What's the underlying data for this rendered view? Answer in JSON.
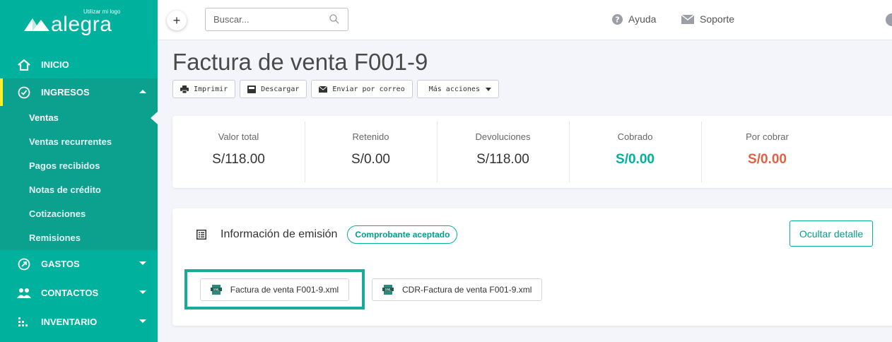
{
  "brand": {
    "tagline": "Utilizar mi logo",
    "name": "alegra"
  },
  "sidebar": {
    "items": [
      {
        "label": "INICIO",
        "icon": "home-icon"
      },
      {
        "label": "INGRESOS",
        "icon": "check-circle-icon",
        "expanded": true
      },
      {
        "label": "GASTOS",
        "icon": "arrow-circle-icon"
      },
      {
        "label": "CONTACTOS",
        "icon": "people-icon"
      },
      {
        "label": "INVENTARIO",
        "icon": "inventory-icon"
      }
    ],
    "ingresos_sub": [
      "Ventas",
      "Ventas recurrentes",
      "Pagos recibidos",
      "Notas de crédito",
      "Cotizaciones",
      "Remisiones"
    ]
  },
  "topbar": {
    "search_placeholder": "Buscar...",
    "help_label": "Ayuda",
    "support_label": "Soporte"
  },
  "page": {
    "title": "Factura de venta F001-9",
    "actions": {
      "print": "Imprimir",
      "download": "Descargar",
      "email": "Enviar por correo",
      "more": "Más acciones"
    }
  },
  "summary": [
    {
      "label": "Valor total",
      "value": "S/118.00"
    },
    {
      "label": "Retenido",
      "value": "S/0.00"
    },
    {
      "label": "Devoluciones",
      "value": "S/118.00"
    },
    {
      "label": "Cobrado",
      "value": "S/0.00"
    },
    {
      "label": "Por cobrar",
      "value": "S/0.00"
    }
  ],
  "emission": {
    "title": "Información de emisión",
    "status": "Comprobante aceptado",
    "hide_label": "Ocultar detalle",
    "files": [
      "Factura de venta F001-9.xml",
      "CDR-Factura de venta F001-9.xml"
    ]
  },
  "colors": {
    "brand": "#00b19d",
    "paid": "#00b19d",
    "due": "#e85e42",
    "highlight_border": "#1aab96"
  }
}
